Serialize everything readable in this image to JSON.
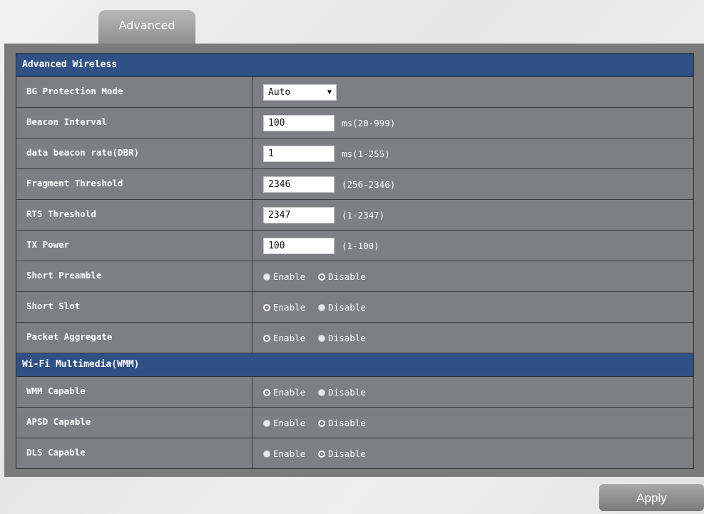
{
  "tab": {
    "label": "Advanced"
  },
  "advanced_wireless": {
    "title": "Advanced Wireless",
    "bg_protection_mode": {
      "label": "BG Protection Mode",
      "value": "Auto"
    },
    "beacon_interval": {
      "label": "Beacon Interval",
      "value": "100",
      "hint": "ms(20-999)"
    },
    "data_beacon_rate": {
      "label": "data beacon rate(DBR)",
      "value": "1",
      "hint": "ms(1-255)"
    },
    "fragment_threshold": {
      "label": "Fragment Threshold",
      "value": "2346",
      "hint": "(256-2346)"
    },
    "rts_threshold": {
      "label": "RTS Threshold",
      "value": "2347",
      "hint": "(1-2347)"
    },
    "tx_power": {
      "label": "TX Power",
      "value": "100",
      "hint": "(1-100)"
    },
    "short_preamble": {
      "label": "Short Preamble",
      "selected": "Disable"
    },
    "short_slot": {
      "label": "Short Slot",
      "selected": "Enable"
    },
    "packet_aggregate": {
      "label": "Packet Aggregate",
      "selected": "Enable"
    }
  },
  "wmm": {
    "title": "Wi-Fi Multimedia(WMM)",
    "wmm_capable": {
      "label": "WMM Capable",
      "selected": "Enable"
    },
    "apsd_capable": {
      "label": "APSD Capable",
      "selected": "Disable"
    },
    "dls_capable": {
      "label": "DLS Capable",
      "selected": "Disable"
    }
  },
  "radio_labels": {
    "enable": "Enable",
    "disable": "Disable"
  },
  "apply_button": {
    "label": "Apply"
  },
  "colors": {
    "section_header": "#2f5186",
    "panel": "#7b7b7b"
  },
  "icons": {
    "select_arrow": "dropdown-arrow-icon"
  }
}
